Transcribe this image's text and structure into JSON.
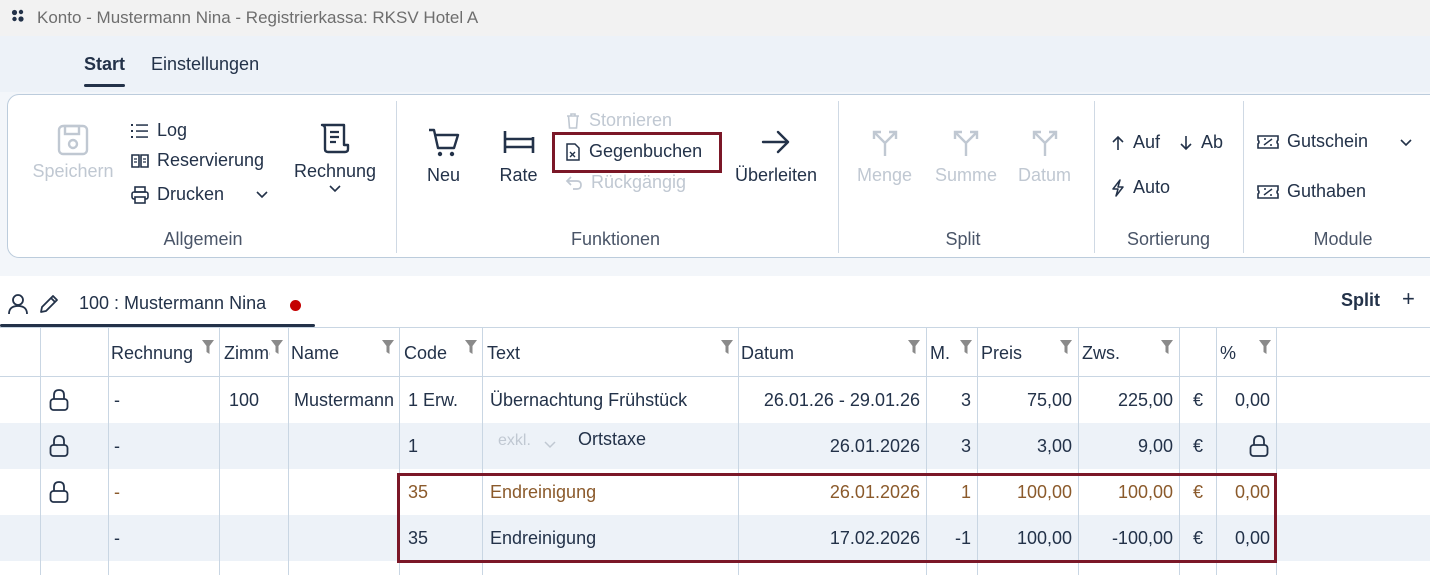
{
  "window": {
    "title": "Konto - Mustermann Nina - Registrierkassa: RKSV Hotel A"
  },
  "menu": {
    "tabs": [
      {
        "label": "Start"
      },
      {
        "label": "Einstellungen"
      }
    ]
  },
  "ribbon": {
    "groups": {
      "allgemein": {
        "label": "Allgemein",
        "speichern": "Speichern",
        "log": "Log",
        "reservierung": "Reservierung",
        "drucken": "Drucken",
        "rechnung": "Rechnung"
      },
      "funktionen": {
        "label": "Funktionen",
        "neu": "Neu",
        "rate": "Rate",
        "stornieren": "Stornieren",
        "gegenbuchen": "Gegenbuchen",
        "rueckgaengig": "Rückgängig",
        "ueberleiten": "Überleiten"
      },
      "split": {
        "label": "Split",
        "menge": "Menge",
        "summe": "Summe",
        "datum": "Datum"
      },
      "sortierung": {
        "label": "Sortierung",
        "auf": "Auf",
        "ab": "Ab",
        "auto": "Auto"
      },
      "module": {
        "label": "Module",
        "gutschein": "Gutschein",
        "guthaben": "Guthaben"
      }
    }
  },
  "account_tab": {
    "label": "100 :  Mustermann Nina",
    "split": "Split",
    "add": "+"
  },
  "table": {
    "columns": [
      "Rechnung",
      "Zimmer",
      "Name",
      "Code",
      "Text",
      "Datum",
      "M.",
      "Preis",
      "Zws.",
      "",
      "%"
    ],
    "rows": [
      {
        "rechnung": "-",
        "zimmer": "100",
        "name": "Mustermann",
        "code": "1 Erw.",
        "text": "Übernachtung Frühstück",
        "datum": "26.01.26 - 29.01.26",
        "menge": "3",
        "preis": "75,00",
        "zws": "225,00",
        "waehrung": "€",
        "prozent": "0,00"
      },
      {
        "rechnung": "-",
        "zimmer": "",
        "name": "",
        "code": "1",
        "tax_mode": "exkl.",
        "text": "Ortstaxe",
        "datum": "26.01.2026",
        "menge": "3",
        "preis": "3,00",
        "zws": "9,00",
        "waehrung": "€",
        "prozent": ""
      },
      {
        "rechnung": "-",
        "zimmer": "",
        "name": "",
        "code": "35",
        "text": "Endreinigung",
        "datum": "26.01.2026",
        "menge": "1",
        "preis": "100,00",
        "zws": "100,00",
        "waehrung": "€",
        "prozent": "0,00"
      },
      {
        "rechnung": "-",
        "zimmer": "",
        "name": "",
        "code": "35",
        "text": "Endreinigung",
        "datum": "17.02.2026",
        "menge": "-1",
        "preis": "100,00",
        "zws": "-100,00",
        "waehrung": "€",
        "prozent": "0,00"
      }
    ]
  },
  "colors": {
    "accent": "#233249",
    "highlight": "#7b1727",
    "storno_text": "#8b5a2b",
    "disabled": "#c0c8d2",
    "alt_row": "#edf2f8"
  }
}
